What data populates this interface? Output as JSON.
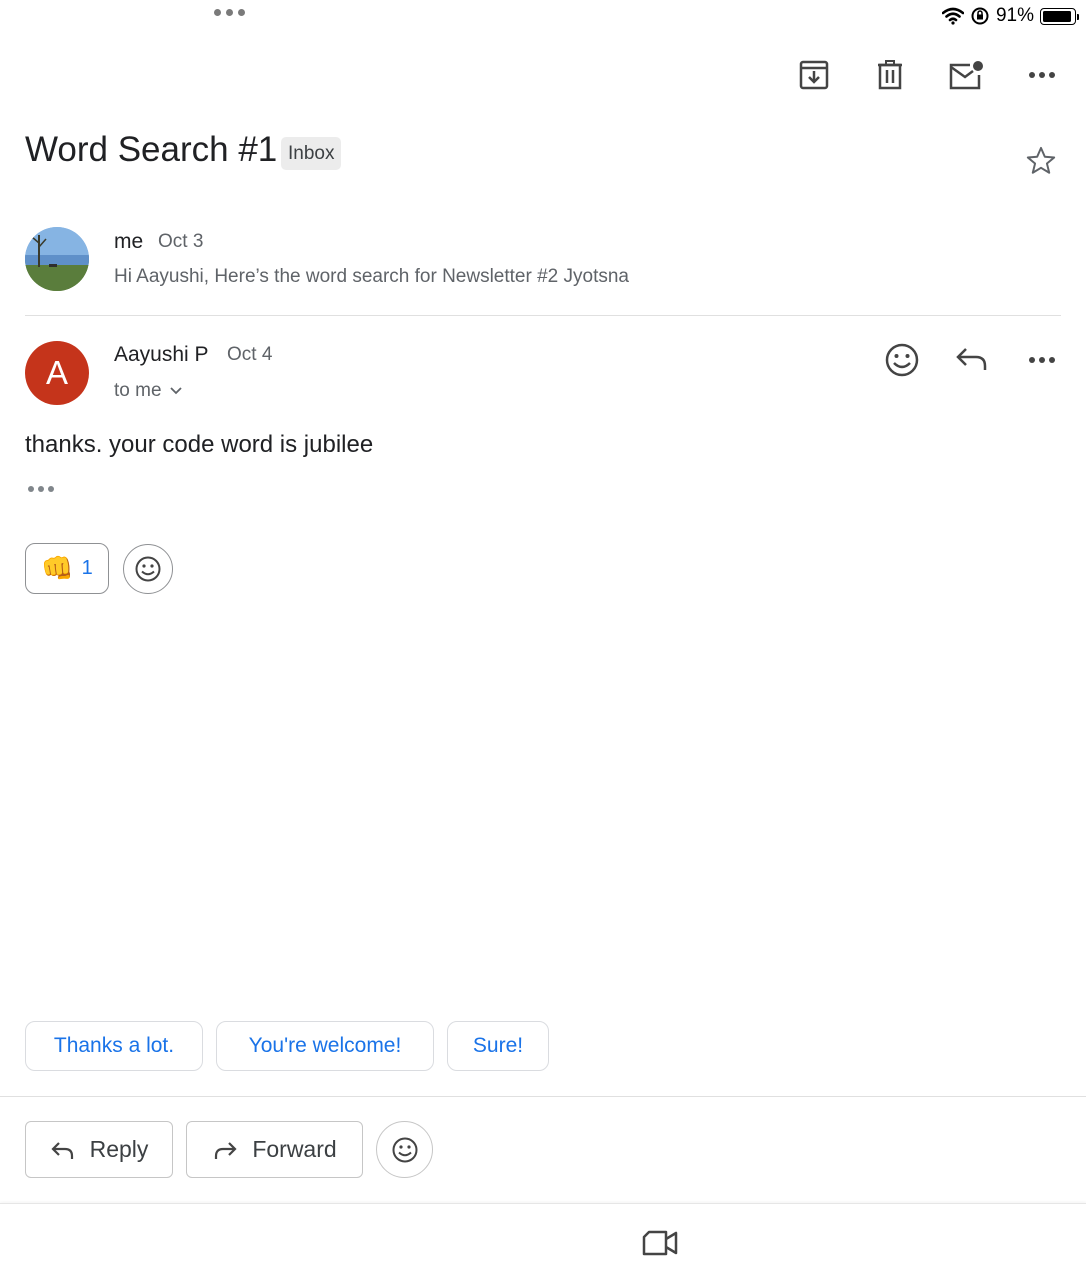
{
  "status_bar": {
    "battery_percent": "91%"
  },
  "toolbar": {
    "archive_icon": "archive-icon",
    "delete_icon": "trash-icon",
    "mark_unread_icon": "mail-unread-icon",
    "more_icon": "more-horizontal-icon"
  },
  "thread": {
    "subject": "Word Search #1",
    "label": "Inbox",
    "starred": false
  },
  "messages": [
    {
      "sender": "me",
      "date": "Oct 3",
      "snippet": "Hi Aayushi, Here’s the word search for Newsletter #2 Jyotsna",
      "collapsed": true
    },
    {
      "sender": "Aayushi P",
      "avatar_letter": "A",
      "date": "Oct 4",
      "recipient_line": "to me",
      "body": "thanks. your code word is jubilee",
      "reaction": {
        "emoji": "👊",
        "count": "1"
      }
    }
  ],
  "smart_replies": [
    "Thanks a lot.",
    "You're welcome!",
    "Sure!"
  ],
  "actions": {
    "reply": "Reply",
    "forward": "Forward"
  },
  "colors": {
    "accent": "#1a73e8",
    "avatar_bg": "#c5341b",
    "label_chip_bg": "#ececec"
  }
}
